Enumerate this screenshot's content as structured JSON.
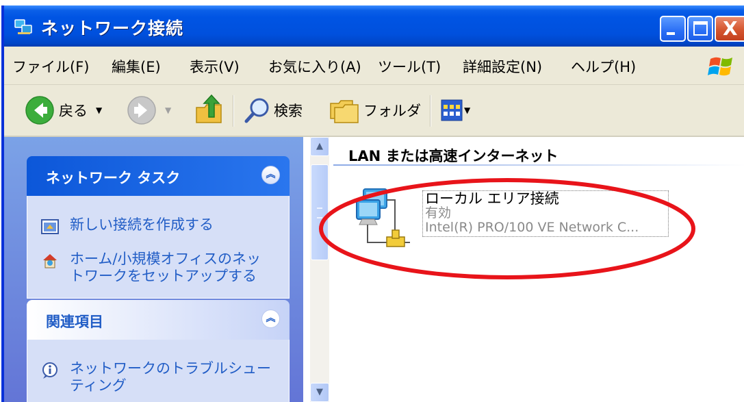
{
  "window": {
    "title": "ネットワーク接続",
    "controls": {
      "minimize_icon": "minimize-icon",
      "maximize_icon": "maximize-icon",
      "close_label": "X"
    }
  },
  "menu": {
    "items": [
      {
        "label": "ファイル(F)"
      },
      {
        "label": "編集(E)"
      },
      {
        "label": "表示(V)"
      },
      {
        "label": "お気に入り(A)"
      },
      {
        "label": "ツール(T)"
      },
      {
        "label": "詳細設定(N)"
      },
      {
        "label": "ヘルプ(H)"
      }
    ]
  },
  "toolbar": {
    "back_label": "戻る",
    "search_label": "検索",
    "folders_label": "フォルダ"
  },
  "taskpane": {
    "network_tasks": {
      "title": "ネットワーク タスク",
      "items": [
        {
          "label": "新しい接続を作成する"
        },
        {
          "label": "ホーム/小規模オフィスのネッ\nトワークをセットアップする"
        }
      ]
    },
    "related": {
      "title": "関連項目",
      "items": [
        {
          "label": "ネットワークのトラブルシュー\nティング"
        }
      ]
    }
  },
  "content": {
    "group_header": "LAN または高速インターネット",
    "connection": {
      "name": "ローカル エリア接続",
      "status": "有効",
      "device": "Intel(R) PRO/100 VE Network C..."
    }
  },
  "colors": {
    "titlebar": "#0054e3",
    "taskpane_bg": "#7ba2e7",
    "panel_body": "#d6dff7",
    "link_text": "#215dc6",
    "highlight_ellipse": "#e8141a"
  }
}
